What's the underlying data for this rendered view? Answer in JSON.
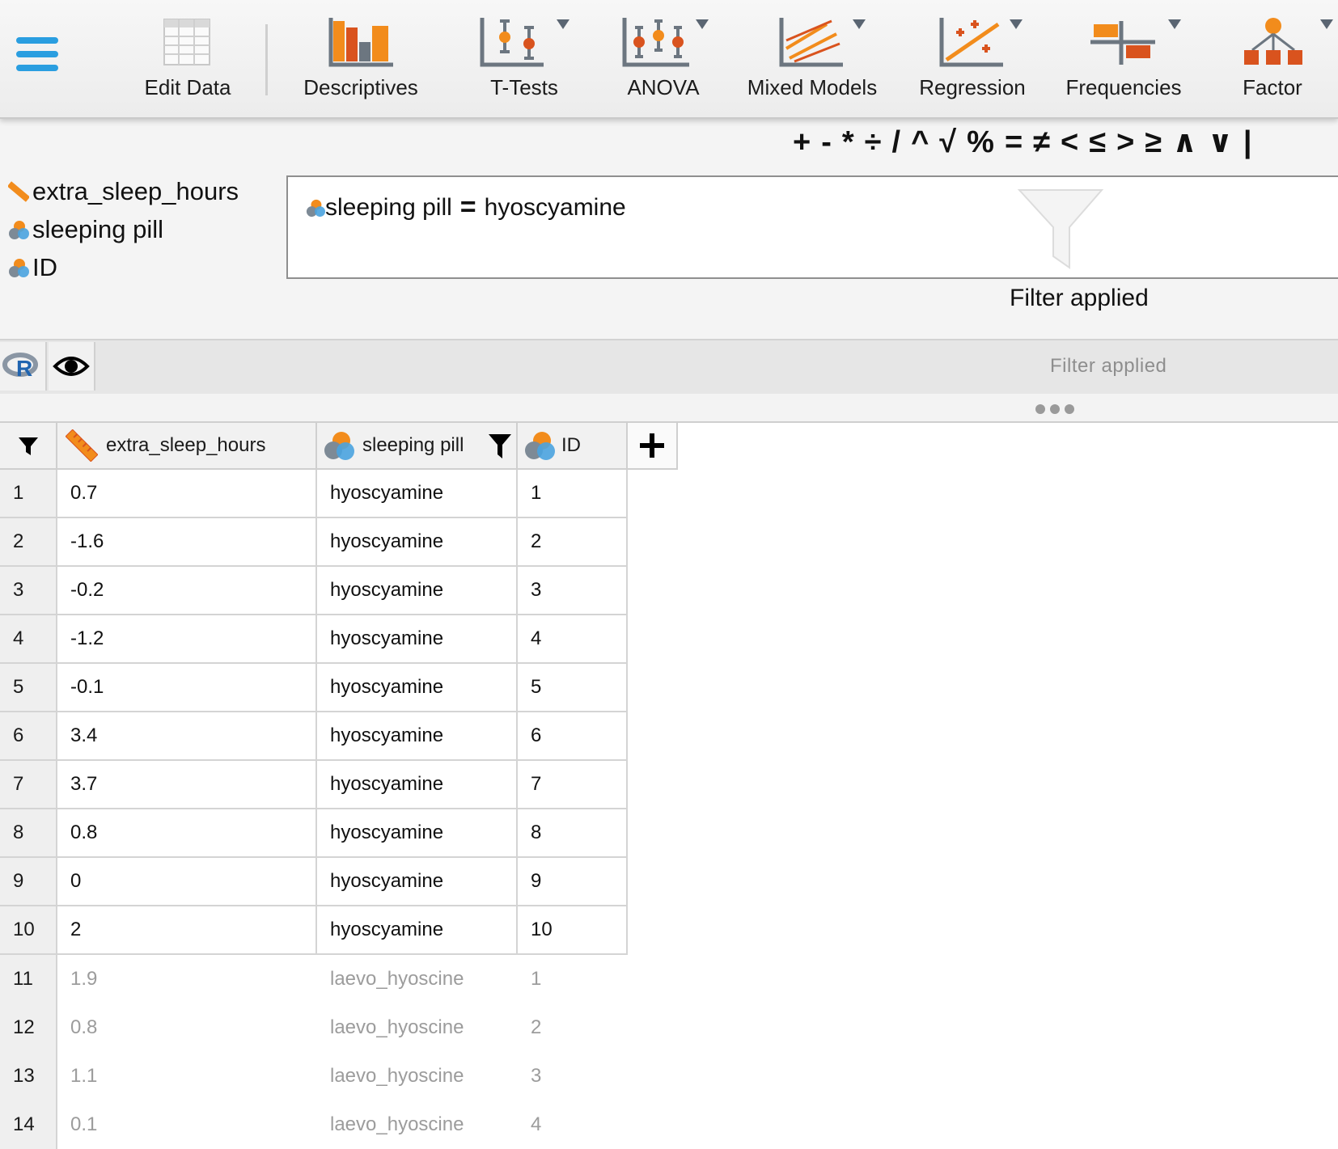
{
  "ribbon": {
    "edit_data": "Edit Data",
    "descriptives": "Descriptives",
    "t_tests": "T-Tests",
    "anova": "ANOVA",
    "mixed_models": "Mixed Models",
    "regression": "Regression",
    "frequencies": "Frequencies",
    "factor": "Factor"
  },
  "operators": [
    "+",
    "-",
    "*",
    "÷",
    "/",
    "^",
    "√",
    "%",
    "=",
    "≠",
    "<",
    "≤",
    ">",
    "≥",
    "∧",
    "∨",
    "|"
  ],
  "variables": [
    "extra_sleep_hours",
    "sleeping pill",
    "ID"
  ],
  "formula": {
    "variable": "sleeping pill",
    "operator": "=",
    "value": "hyoscyamine"
  },
  "filter_status": "Filter applied",
  "filter_status_strip": "Filter applied",
  "colors": {
    "accent_blue": "#2a9ee0",
    "orange": "#f28c1c",
    "dark_orange": "#d9531e"
  },
  "table": {
    "columns": [
      "extra_sleep_hours",
      "sleeping pill",
      "ID"
    ],
    "rows": [
      {
        "n": "1",
        "extra": "0.7",
        "pill": "hyoscyamine",
        "id": "1",
        "filtered": false
      },
      {
        "n": "2",
        "extra": "-1.6",
        "pill": "hyoscyamine",
        "id": "2",
        "filtered": false
      },
      {
        "n": "3",
        "extra": "-0.2",
        "pill": "hyoscyamine",
        "id": "3",
        "filtered": false
      },
      {
        "n": "4",
        "extra": "-1.2",
        "pill": "hyoscyamine",
        "id": "4",
        "filtered": false
      },
      {
        "n": "5",
        "extra": "-0.1",
        "pill": "hyoscyamine",
        "id": "5",
        "filtered": false
      },
      {
        "n": "6",
        "extra": "3.4",
        "pill": "hyoscyamine",
        "id": "6",
        "filtered": false
      },
      {
        "n": "7",
        "extra": "3.7",
        "pill": "hyoscyamine",
        "id": "7",
        "filtered": false
      },
      {
        "n": "8",
        "extra": "0.8",
        "pill": "hyoscyamine",
        "id": "8",
        "filtered": false
      },
      {
        "n": "9",
        "extra": "0",
        "pill": "hyoscyamine",
        "id": "9",
        "filtered": false
      },
      {
        "n": "10",
        "extra": "2",
        "pill": "hyoscyamine",
        "id": "10",
        "filtered": false
      },
      {
        "n": "11",
        "extra": "1.9",
        "pill": "laevo_hyoscine",
        "id": "1",
        "filtered": true
      },
      {
        "n": "12",
        "extra": "0.8",
        "pill": "laevo_hyoscine",
        "id": "2",
        "filtered": true
      },
      {
        "n": "13",
        "extra": "1.1",
        "pill": "laevo_hyoscine",
        "id": "3",
        "filtered": true
      },
      {
        "n": "14",
        "extra": "0.1",
        "pill": "laevo_hyoscine",
        "id": "4",
        "filtered": true
      }
    ]
  }
}
